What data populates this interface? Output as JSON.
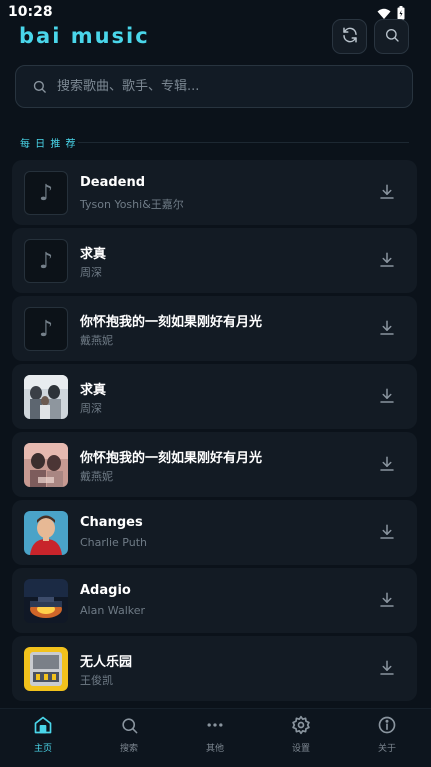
{
  "status": {
    "time": "10:28"
  },
  "header": {
    "title": "bai music"
  },
  "search": {
    "placeholder": "搜索歌曲、歌手、专辑..."
  },
  "section": {
    "title": "每 日 推 荐"
  },
  "songs": [
    {
      "title": "Deadend",
      "artist": "Tyson Yoshi&王嘉尔",
      "cover": "placeholder"
    },
    {
      "title": "求真",
      "artist": "周深",
      "cover": "placeholder"
    },
    {
      "title": "你怀抱我的一刻如果刚好有月光",
      "artist": "戴燕妮",
      "cover": "placeholder"
    },
    {
      "title": "求真",
      "artist": "周深",
      "cover": "image"
    },
    {
      "title": "你怀抱我的一刻如果刚好有月光",
      "artist": "戴燕妮",
      "cover": "image"
    },
    {
      "title": "Changes",
      "artist": "Charlie Puth",
      "cover": "image"
    },
    {
      "title": "Adagio",
      "artist": "Alan Walker",
      "cover": "image"
    },
    {
      "title": "无人乐园",
      "artist": "王俊凯",
      "cover": "image"
    }
  ],
  "nav": {
    "home": "主页",
    "search": "搜索",
    "more": "其他",
    "settings": "设置",
    "about": "关于"
  },
  "colors": {
    "accent": "#4ad6ea",
    "background": "#0b121a",
    "card": "#131b24"
  },
  "icons": [
    "wifi-icon",
    "battery-icon",
    "refresh-icon",
    "search-icon",
    "music-note-icon",
    "download-icon",
    "home-icon",
    "more-icon",
    "gear-icon",
    "info-icon"
  ]
}
